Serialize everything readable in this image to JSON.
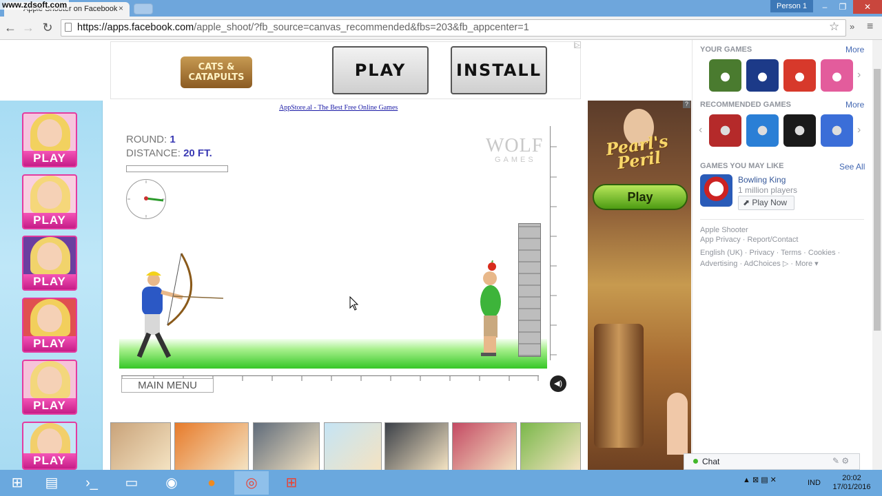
{
  "browser": {
    "watermark": "www.zdsoft.com",
    "tab_title": "Apple Shooter on Facebook",
    "tab_close": "×",
    "person": "Person 1",
    "window_controls": [
      "–",
      "❐",
      "✕"
    ],
    "url_domain": "https://apps.facebook.com",
    "url_path": "/apple_shoot/?fb_source=canvas_recommended&fbs=203&fb_appcenter=1",
    "back": "←",
    "forward": "→",
    "reload": "↻",
    "star": "☆",
    "ext": "»",
    "menu": "≡"
  },
  "left_sidebar": {
    "play_label": "PLAY",
    "items": [
      {
        "hair": "#f2d15f",
        "bg": "#f7c5dd"
      },
      {
        "hair": "#f5d77a",
        "bg": "#f9d0e0"
      },
      {
        "hair": "#f1d36b",
        "bg": "#6a3fa0"
      },
      {
        "hair": "#f2cf5c",
        "bg": "#e05050"
      },
      {
        "hair": "#f3d77c",
        "bg": "#f6c3d9"
      },
      {
        "hair": "#f2cf6b",
        "bg": "#c5e6f6"
      }
    ]
  },
  "banner": {
    "logo_text": "CATS & CATAPULTS",
    "play_label": "PLAY",
    "install_label": "INSTALL",
    "ad_marker": "▷",
    "appstore_link": "AppStore.al - The Best Free Online Games"
  },
  "game": {
    "round_label": "ROUND:",
    "round_value": "1",
    "distance_label": "DISTANCE:",
    "distance_value": "20 FT.",
    "wolf_logo": "WOLF",
    "wolf_sub": "GAMES",
    "main_menu": "MAIN MENU",
    "sound_icon": "◀)"
  },
  "bottom_thumbs": [
    {
      "color": "#c9a37a"
    },
    {
      "color": "#e77b2b"
    },
    {
      "color": "#5f6b7a"
    },
    {
      "color": "#c5e4f5"
    },
    {
      "color": "#3b4048"
    },
    {
      "color": "#c44a63"
    },
    {
      "color": "#7ab84a"
    }
  ],
  "right_ad": {
    "title": "Pearl's Peril",
    "play_label": "Play",
    "ad_marker": "?"
  },
  "right_panel": {
    "your_games": "YOUR GAMES",
    "recommended_games": "RECOMMENDED GAMES",
    "games_you_may_like": "GAMES YOU MAY LIKE",
    "more": "More",
    "see_all": "See All",
    "your_game_colors": [
      "#4a7b2f",
      "#1c3a88",
      "#d7392b",
      "#e35c9c"
    ],
    "rec_game_colors": [
      "#b52a2a",
      "#2a7fd6",
      "#1a1a1a",
      "#3b6ed8"
    ],
    "bowling_name": "Bowling King",
    "bowling_players": "1 million players",
    "play_now": "Play Now",
    "footer_line1": "Apple Shooter",
    "footer_line2": "App Privacy · Report/Contact",
    "footer_line3": "English (UK) · Privacy · Terms · Cookies ·",
    "footer_line4": "Advertising · AdChoices ▷ · More ▾"
  },
  "chat": {
    "label": "Chat"
  },
  "taskbar": {
    "tray": "▲  ⊠  ▤  ✕",
    "lang": "IND",
    "time": "20:02",
    "date": "17/01/2016"
  }
}
